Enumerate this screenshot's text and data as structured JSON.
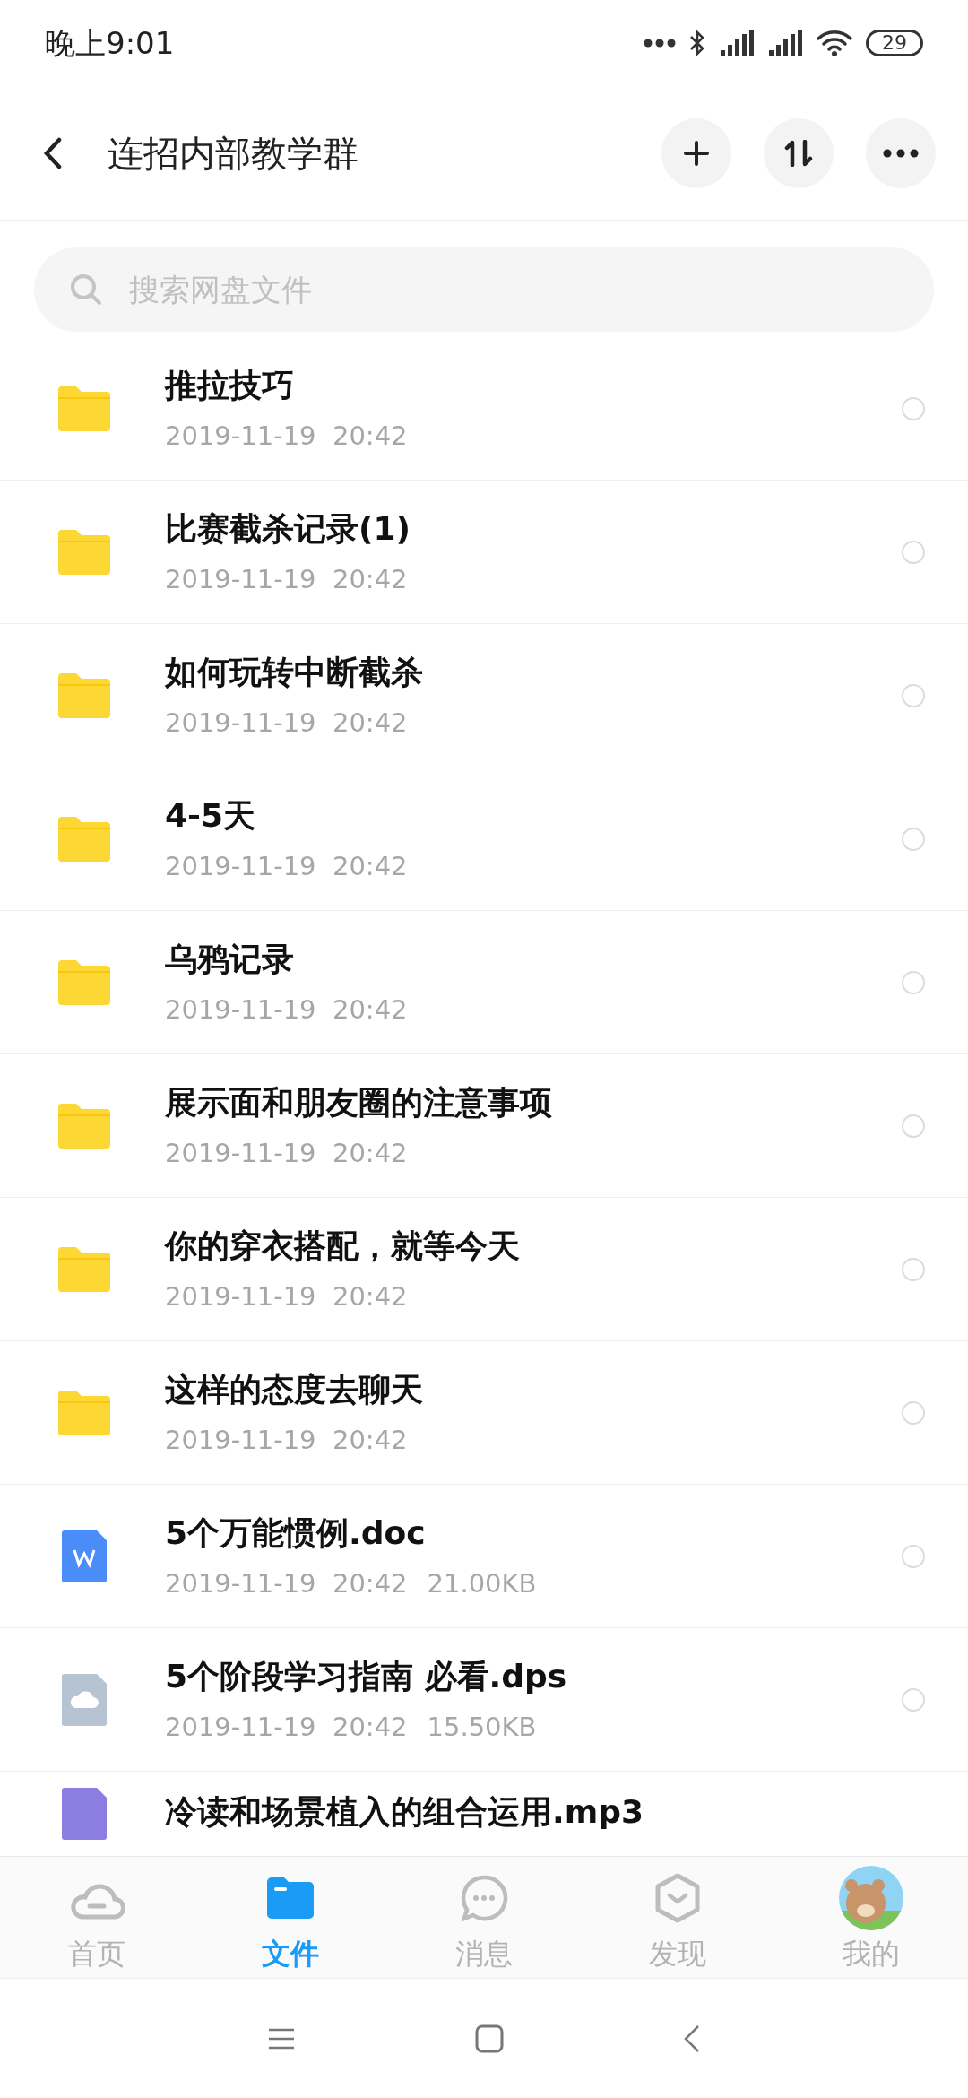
{
  "status_bar": {
    "time": "晚上9:01",
    "battery": "29"
  },
  "header": {
    "title": "连招内部教学群"
  },
  "search": {
    "placeholder": "搜索网盘文件"
  },
  "files": [
    {
      "kind": "folder",
      "name": "推拉技巧",
      "date": "2019-11-19  20:42",
      "selected": false
    },
    {
      "kind": "folder",
      "name": "比赛截杀记录(1)",
      "date": "2019-11-19  20:42",
      "selected": false
    },
    {
      "kind": "folder",
      "name": "如何玩转中断截杀",
      "date": "2019-11-19  20:42",
      "selected": false
    },
    {
      "kind": "folder",
      "name": "4-5天",
      "date": "2019-11-19  20:42",
      "selected": false
    },
    {
      "kind": "folder",
      "name": "乌鸦记录",
      "date": "2019-11-19  20:42",
      "selected": false
    },
    {
      "kind": "folder",
      "name": "展示面和朋友圈的注意事项",
      "date": "2019-11-19  20:42",
      "selected": false
    },
    {
      "kind": "folder",
      "name": "你的穿衣搭配，就等今天",
      "date": "2019-11-19  20:42",
      "selected": false
    },
    {
      "kind": "folder",
      "name": "这样的态度去聊天",
      "date": "2019-11-19  20:42",
      "selected": false
    },
    {
      "kind": "doc",
      "name": "5个万能惯例.doc",
      "date": "2019-11-19  20:42",
      "size": "21.00KB",
      "selected": false
    },
    {
      "kind": "cloud",
      "name": "5个阶段学习指南 必看.dps",
      "date": "2019-11-19  20:42",
      "size": "15.50KB",
      "selected": false
    },
    {
      "kind": "audio",
      "name": "冷读和场景植入的组合运用.mp3"
    }
  ],
  "tabs": [
    {
      "kind": "home",
      "label": "首页",
      "selected": false
    },
    {
      "kind": "files",
      "label": "文件",
      "selected": true
    },
    {
      "kind": "messages",
      "label": "消息",
      "selected": false
    },
    {
      "kind": "discover",
      "label": "发现",
      "selected": false
    },
    {
      "kind": "profile",
      "label": "我的",
      "selected": false
    }
  ]
}
